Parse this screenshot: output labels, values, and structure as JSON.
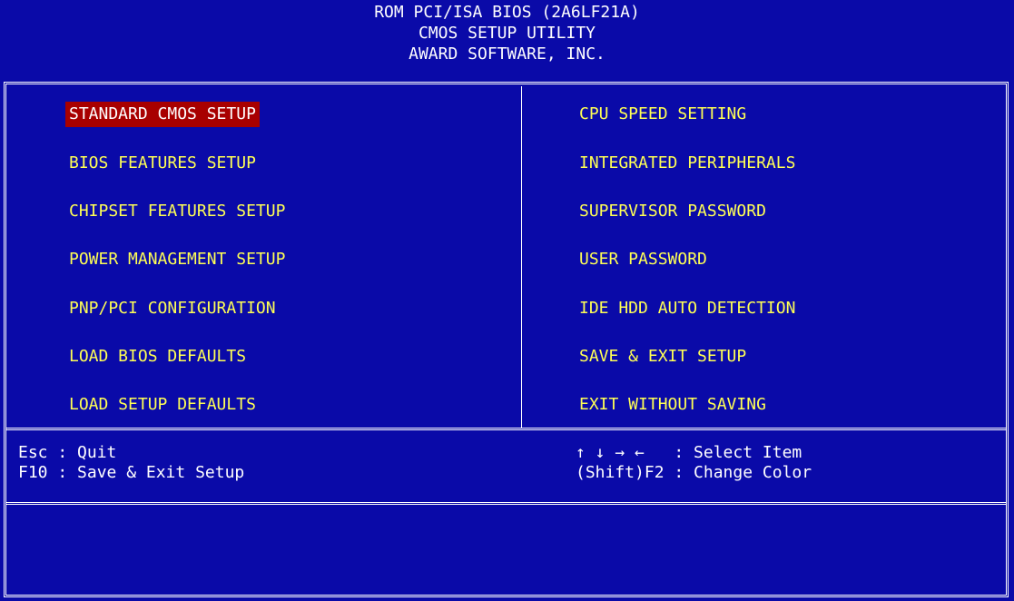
{
  "header": {
    "line1": "ROM PCI/ISA BIOS (2A6LF21A)",
    "line2": "CMOS SETUP UTILITY",
    "line3": "AWARD SOFTWARE, INC."
  },
  "menu": {
    "left": [
      {
        "label": "STANDARD CMOS SETUP",
        "selected": true
      },
      {
        "label": "BIOS FEATURES SETUP",
        "selected": false
      },
      {
        "label": "CHIPSET FEATURES SETUP",
        "selected": false
      },
      {
        "label": "POWER MANAGEMENT SETUP",
        "selected": false
      },
      {
        "label": "PNP/PCI CONFIGURATION",
        "selected": false
      },
      {
        "label": "LOAD BIOS DEFAULTS",
        "selected": false
      },
      {
        "label": "LOAD SETUP DEFAULTS",
        "selected": false
      }
    ],
    "right": [
      {
        "label": "CPU SPEED SETTING",
        "selected": false
      },
      {
        "label": "INTEGRATED PERIPHERALS",
        "selected": false
      },
      {
        "label": "SUPERVISOR PASSWORD",
        "selected": false
      },
      {
        "label": "USER PASSWORD",
        "selected": false
      },
      {
        "label": "IDE HDD AUTO DETECTION",
        "selected": false
      },
      {
        "label": "SAVE & EXIT SETUP",
        "selected": false
      },
      {
        "label": "EXIT WITHOUT SAVING",
        "selected": false
      }
    ]
  },
  "help": {
    "esc": "Esc : Quit",
    "f10": "F10 : Save & Exit Setup",
    "arrows": "↑ ↓ → ←   : Select Item",
    "shift_f2": "(Shift)F2 : Change Color"
  },
  "description": "",
  "colors": {
    "background": "#0a0aa8",
    "menu_text": "#ffff55",
    "highlight_bg": "#a80000",
    "frame": "#ffffff"
  }
}
